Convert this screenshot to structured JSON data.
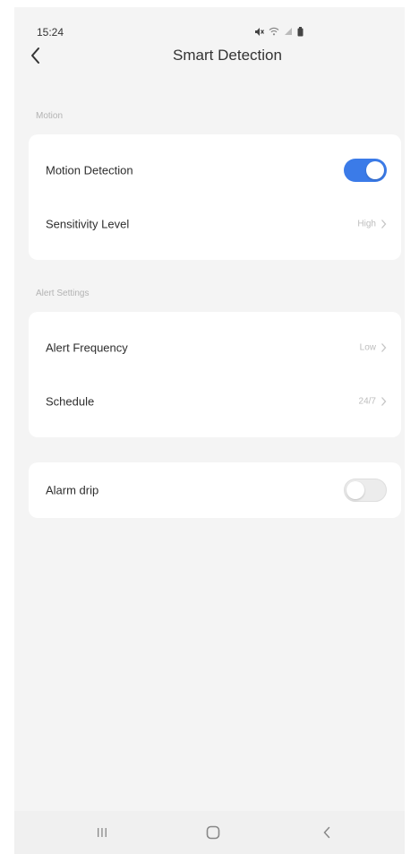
{
  "status_bar": {
    "time": "15:24",
    "icons": [
      "mute-icon",
      "wifi-icon",
      "signal-icon",
      "battery-icon"
    ]
  },
  "header": {
    "title": "Smart Detection",
    "back_icon": "chevron-left-icon"
  },
  "sections": {
    "motion": {
      "label": "Motion",
      "motion_detection": {
        "label": "Motion Detection",
        "enabled": true
      },
      "sensitivity": {
        "label": "Sensitivity Level",
        "value": "High"
      }
    },
    "alert": {
      "label": "Alert Settings",
      "frequency": {
        "label": "Alert Frequency",
        "value": "Low"
      },
      "schedule": {
        "label": "Schedule",
        "value": "24/7"
      }
    },
    "alarm": {
      "alarm_drip": {
        "label": "Alarm drip",
        "enabled": false
      }
    }
  },
  "nav": {
    "recents": "recents-icon",
    "home": "home-icon",
    "back": "back-icon"
  },
  "colors": {
    "accent": "#3b7be8",
    "background": "#f4f4f4",
    "card": "#ffffff"
  }
}
